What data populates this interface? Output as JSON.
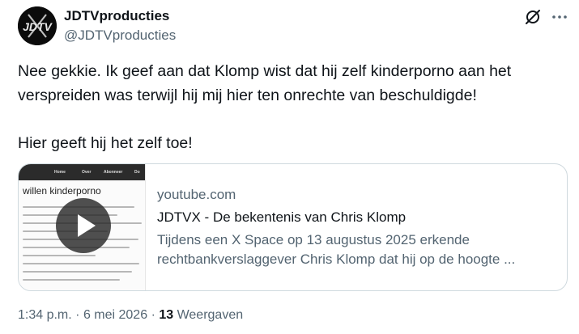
{
  "author": {
    "display_name": "JDTVproducties",
    "handle": "@JDTVproducties",
    "avatar_text": "JDTV"
  },
  "header": {
    "grok_icon": "grok-icon",
    "more_icon": "more-icon"
  },
  "post": {
    "text": "Nee gekkie. Ik geef aan dat Klomp wist dat hij zelf kinderporno aan het verspreiden was terwijl hij mij hier ten onrechte van beschuldigde!\n\nHier geeft hij het zelf toe!"
  },
  "link_card": {
    "thumbnail": {
      "nav_items": [
        "Home",
        "Over",
        "Abonneer",
        "Do"
      ],
      "title": "willen kinderporno",
      "play_icon": "play-icon"
    },
    "domain": "youtube.com",
    "title": "JDTVX - De bekentenis van Chris Klomp",
    "description_lines": [
      "Tijdens een X Space op 13 augustus 2025 erkende",
      "rechtbankverslaggever Chris Klomp dat hij op de hoogte ..."
    ]
  },
  "meta": {
    "time": "1:34 p.m.",
    "separator": "·",
    "date": "6 mei 2026",
    "views_count": "13",
    "views_label": "Weergaven"
  },
  "colors": {
    "text_primary": "#0f1419",
    "text_secondary": "#536471",
    "card_border": "#cfd9de"
  }
}
